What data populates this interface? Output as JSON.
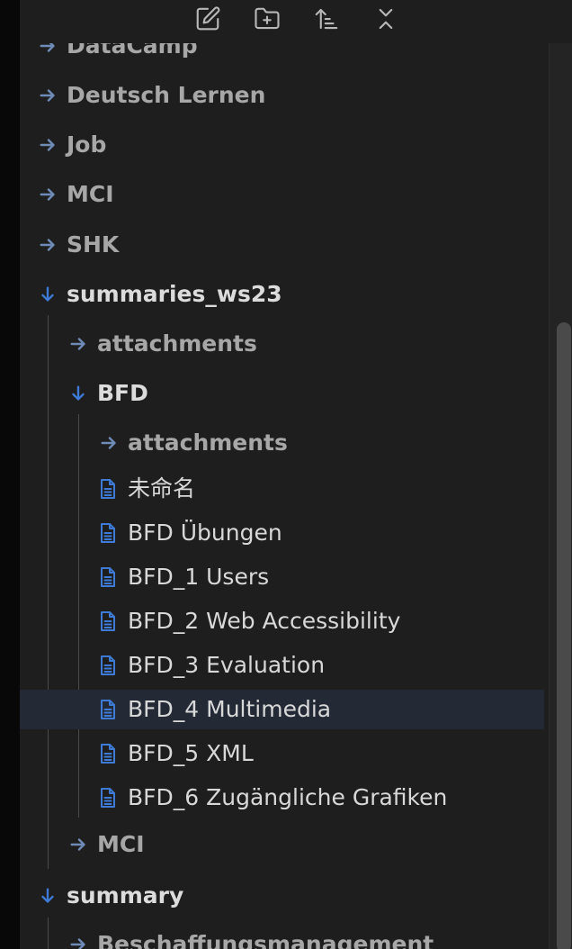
{
  "toolbar": {
    "buttons": [
      {
        "name": "new-note-button",
        "icon": "edit-icon"
      },
      {
        "name": "new-folder-button",
        "icon": "folder-plus-icon"
      },
      {
        "name": "sort-button",
        "icon": "sort-ascending-icon"
      },
      {
        "name": "collapse-all-button",
        "icon": "collapse-all-icon"
      }
    ]
  },
  "tree": {
    "items": [
      {
        "label": "DataCamp",
        "kind": "folder",
        "expanded": false,
        "depth": 0
      },
      {
        "label": "Deutsch Lernen",
        "kind": "folder",
        "expanded": false,
        "depth": 0
      },
      {
        "label": "Job",
        "kind": "folder",
        "expanded": false,
        "depth": 0
      },
      {
        "label": "MCI",
        "kind": "folder",
        "expanded": false,
        "depth": 0
      },
      {
        "label": "SHK",
        "kind": "folder",
        "expanded": false,
        "depth": 0
      },
      {
        "label": "summaries_ws23",
        "kind": "folder",
        "expanded": true,
        "depth": 0
      },
      {
        "label": "attachments",
        "kind": "folder",
        "expanded": false,
        "depth": 1
      },
      {
        "label": "BFD",
        "kind": "folder",
        "expanded": true,
        "depth": 1
      },
      {
        "label": "attachments",
        "kind": "folder",
        "expanded": false,
        "depth": 2
      },
      {
        "label": "未命名",
        "kind": "file",
        "depth": 2
      },
      {
        "label": "BFD Übungen",
        "kind": "file",
        "depth": 2
      },
      {
        "label": "BFD_1 Users",
        "kind": "file",
        "depth": 2
      },
      {
        "label": "BFD_2 Web Accessibility",
        "kind": "file",
        "depth": 2
      },
      {
        "label": "BFD_3 Evaluation",
        "kind": "file",
        "depth": 2
      },
      {
        "label": "BFD_4 Multimedia",
        "kind": "file",
        "depth": 2,
        "active": true
      },
      {
        "label": "BFD_5 XML",
        "kind": "file",
        "depth": 2
      },
      {
        "label": "BFD_6 Zugängliche Grafiken",
        "kind": "file",
        "depth": 2
      },
      {
        "label": "MCI",
        "kind": "folder",
        "expanded": false,
        "depth": 1
      },
      {
        "label": "summary",
        "kind": "folder",
        "expanded": true,
        "depth": 0
      },
      {
        "label": "Beschaffungsmanagement",
        "kind": "folder",
        "expanded": false,
        "depth": 1
      }
    ]
  },
  "colors": {
    "background": "#1e1e1e",
    "accent": "#3d7bd6",
    "active_row": "#232a36",
    "closed_folder_text": "#a7a7a7",
    "open_folder_text": "#dcdcdc",
    "file_text": "#d8d8d8"
  }
}
